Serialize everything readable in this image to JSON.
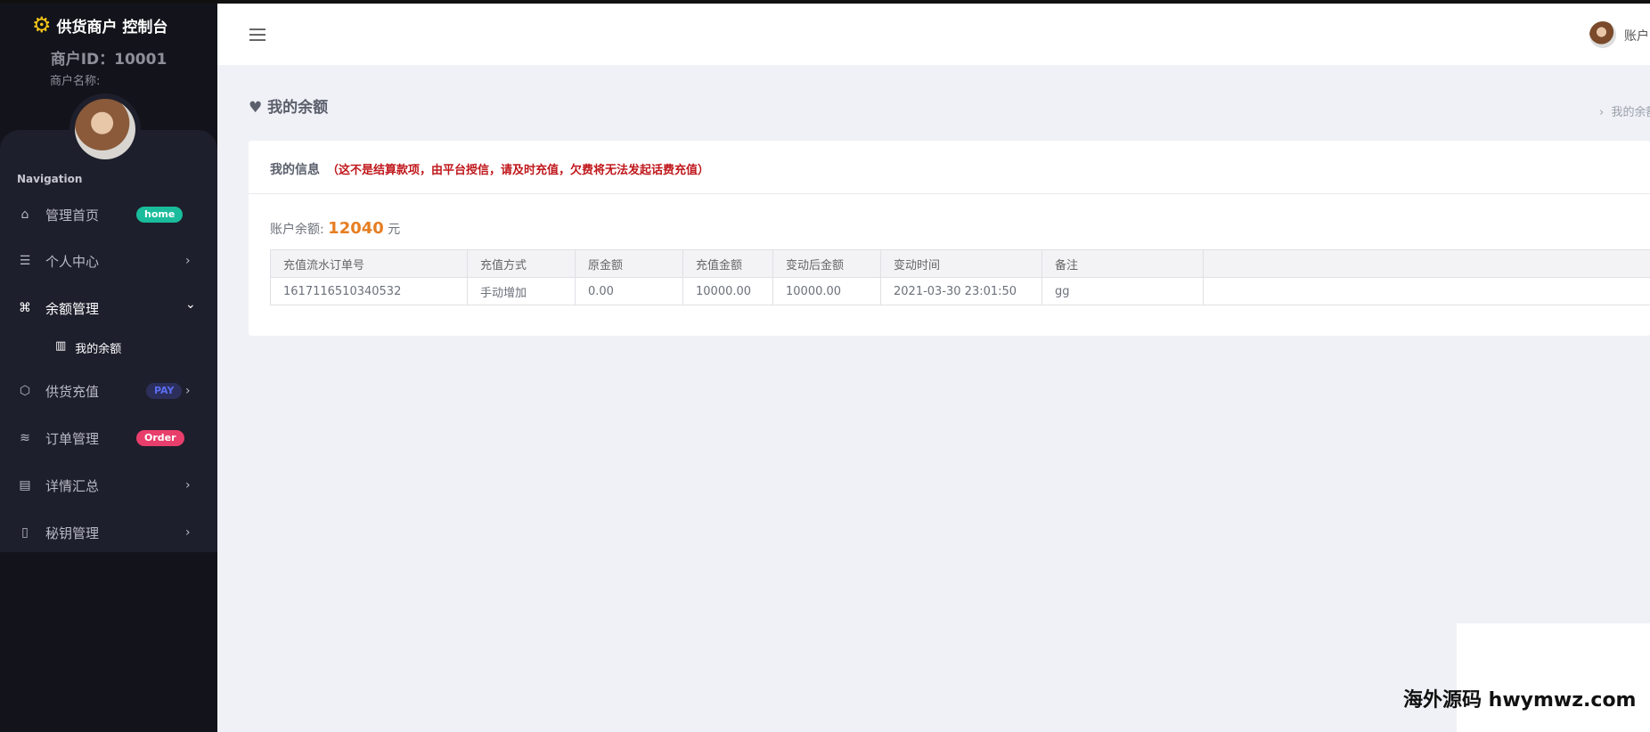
{
  "sidebar": {
    "brand": "供货商户 控制台",
    "merchant_id": "商户ID：10001",
    "merchant_name": "商户名称:",
    "nav_label": "Navigation",
    "items": [
      {
        "label": "管理首页",
        "icon": "home-icon",
        "badge": "home",
        "badge_color": "#1abc9c"
      },
      {
        "label": "个人中心",
        "icon": "list-icon",
        "chevron": "›"
      },
      {
        "label": "余额管理",
        "icon": "command-icon",
        "chevron": "⌄"
      },
      {
        "label": "供货充值",
        "icon": "box-icon",
        "badge": "PAY",
        "badge_color": "#2b2f5a",
        "chevron": "›"
      },
      {
        "label": "订单管理",
        "icon": "layers-icon",
        "badge": "Order",
        "badge_color": "#e83e6c"
      },
      {
        "label": "详情汇总",
        "icon": "document-icon",
        "chevron": "›"
      },
      {
        "label": "秘钥管理",
        "icon": "map-icon",
        "chevron": "›"
      }
    ],
    "sub_item": "我的余额"
  },
  "topbar": {
    "user": "账户"
  },
  "page": {
    "title": "我的余额",
    "breadcrumb": "我的余额"
  },
  "card": {
    "title": "我的信息",
    "warning": "（这不是结算款项，由平台授信，请及时充值，欠费将无法发起话费充值）",
    "balance_label": "账户余额:",
    "balance": "12040",
    "unit": "元",
    "columns": [
      "充值流水订单号",
      "充值方式",
      "原金额",
      "充值金额",
      "变动后金额",
      "变动时间",
      "备注",
      ""
    ],
    "rows": [
      [
        "1617116510340532",
        "手动增加",
        "0.00",
        "10000.00",
        "10000.00",
        "2021-03-30 23:01:50",
        "gg",
        ""
      ]
    ]
  },
  "watermark": "海外源码 hwymwz.com"
}
